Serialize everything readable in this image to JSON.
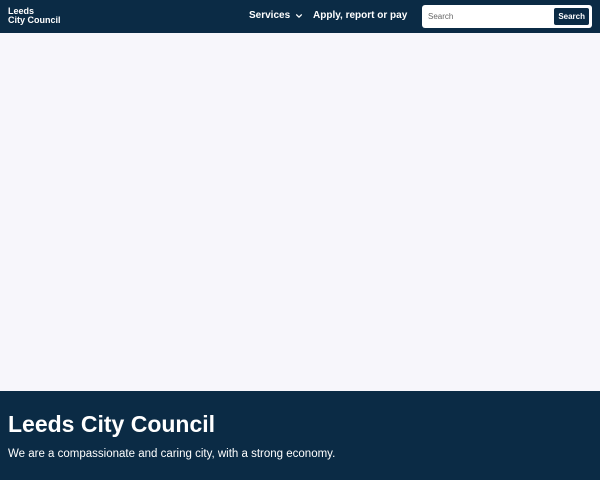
{
  "header": {
    "logo_line1": "Leeds",
    "logo_line2": "City Council",
    "nav": {
      "services_label": "Services",
      "apply_label": "Apply, report or pay"
    },
    "search": {
      "placeholder": "Search",
      "value": "",
      "button_label": "Search"
    }
  },
  "hero": {
    "title": "Leeds City Council",
    "subtitle": "We are a compassionate and caring city, with a strong economy."
  },
  "colors": {
    "brand": "#0b2b45",
    "page_background": "#f7f6fb",
    "text_on_brand": "#ffffff"
  },
  "icons": {
    "services_dropdown": "chevron-down-icon"
  }
}
